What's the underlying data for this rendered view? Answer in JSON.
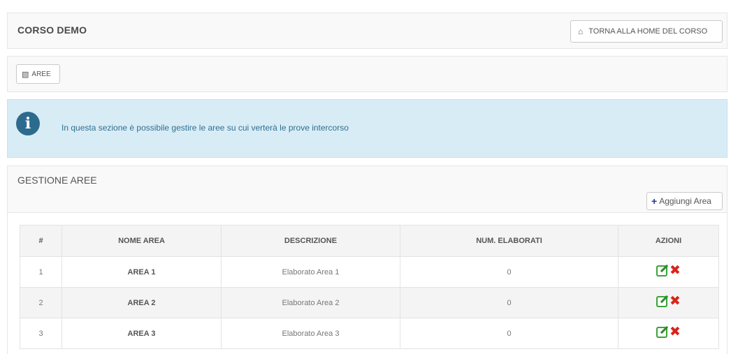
{
  "header": {
    "title": "CORSO DEMO",
    "home_button": "TORNA ALLA HOME DEL CORSO"
  },
  "tabs": {
    "aree_label": "AREE"
  },
  "info": {
    "icon_glyph": "i",
    "text": "In questa sezione è possibile gestire le aree su cui verterà le prove intercorso"
  },
  "main": {
    "title": "GESTIONE AREE",
    "add_button": "Aggiungi Area",
    "columns": [
      "#",
      "NOME AREA",
      "DESCRIZIONE",
      "NUM. ELABORATI",
      "AZIONI"
    ],
    "rows": [
      {
        "n": "1",
        "nome": "AREA 1",
        "descrizione": "Elaborato Area 1",
        "elaborati": "0"
      },
      {
        "n": "2",
        "nome": "AREA 2",
        "descrizione": "Elaborato Area 2",
        "elaborati": "0"
      },
      {
        "n": "3",
        "nome": "AREA 3",
        "descrizione": "Elaborato Area 3",
        "elaborati": "0"
      }
    ]
  },
  "icons": {
    "home": "home-icon",
    "aree": "puzzle-icon",
    "info": "info-icon",
    "add": "plus-icon",
    "edit": "edit-icon",
    "delete": "delete-icon"
  },
  "colors": {
    "info_background": "#d8ecf5",
    "info_text": "#2f6f92",
    "edit_green": "#3aa339",
    "delete_red": "#d9241a",
    "add_blue": "#1b3b8c"
  }
}
